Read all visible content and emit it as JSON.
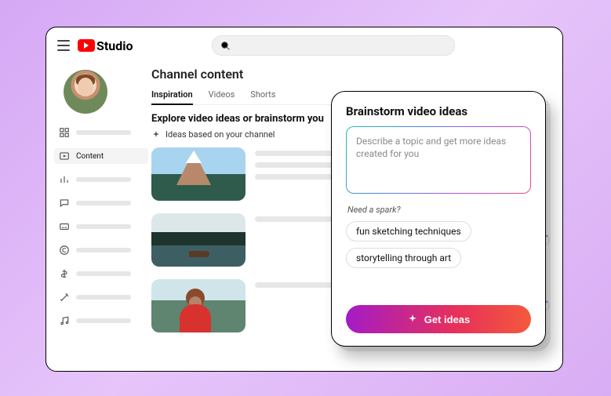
{
  "header": {
    "logo_text": "Studio"
  },
  "sidebar": {
    "active_label": "Content"
  },
  "main": {
    "title": "Channel content",
    "tabs": [
      {
        "label": "Inspiration",
        "active": true
      },
      {
        "label": "Videos",
        "active": false
      },
      {
        "label": "Shorts",
        "active": false
      }
    ],
    "explore_heading": "Explore video ideas or brainstorm you",
    "ideas_subline": "Ideas based on your channel"
  },
  "overlay": {
    "title": "Brainstorm video ideas",
    "placeholder": "Describe a topic and get more ideas created for you",
    "spark_prompt": "Need a spark?",
    "chips": [
      "fun sketching techniques",
      "storytelling through art"
    ],
    "cta": "Get ideas"
  }
}
